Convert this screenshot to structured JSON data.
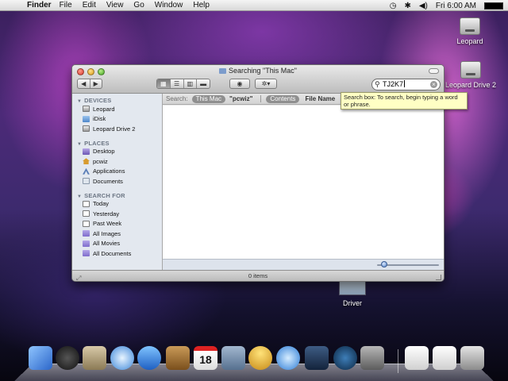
{
  "menubar": {
    "app_name": "Finder",
    "items": [
      "File",
      "Edit",
      "View",
      "Go",
      "Window",
      "Help"
    ],
    "clock": "Fri 6:00 AM",
    "status_icons": [
      "time-machine-icon",
      "bluetooth-icon",
      "volume-icon",
      "battery-icon"
    ]
  },
  "desktop": {
    "icons": [
      {
        "label": "Leopard"
      },
      {
        "label": "Leopard Drive 2"
      },
      {
        "label": "Driver"
      }
    ]
  },
  "window": {
    "title": "Searching \"This Mac\"",
    "search_value": "TJ2K7",
    "view_buttons": [
      "icon",
      "list",
      "column",
      "cover-flow"
    ],
    "search_bar": {
      "label": "Search:",
      "scope_this_mac": "This Mac",
      "scope_user": "\"pcwiz\"",
      "contents": "Contents",
      "file_name": "File Name"
    },
    "status": "0 items"
  },
  "tooltip": {
    "text": "Search box: To search, begin typing a word or phrase."
  },
  "sidebar": {
    "devices_header": "DEVICES",
    "devices": [
      "Leopard",
      "iDisk",
      "Leopard Drive 2"
    ],
    "places_header": "PLACES",
    "places": [
      "Desktop",
      "pcwiz",
      "Applications",
      "Documents"
    ],
    "search_header": "SEARCH FOR",
    "searches": [
      "Today",
      "Yesterday",
      "Past Week",
      "All Images",
      "All Movies",
      "All Documents"
    ]
  },
  "dock": {
    "items": [
      "Finder",
      "Dashboard",
      "Mail",
      "Safari",
      "iChat",
      "Address Book",
      "iCal",
      "Preview",
      "iTunes",
      "Spaces",
      "Time Machine",
      "System Preferences",
      "Applications stack",
      "Documents stack",
      "Trash"
    ],
    "calendar_date": "18"
  },
  "colors": {
    "accent": "#4f7fc6",
    "tooltip_bg": "#ffffc4",
    "sidebar_bg": "#e3e8ef"
  }
}
